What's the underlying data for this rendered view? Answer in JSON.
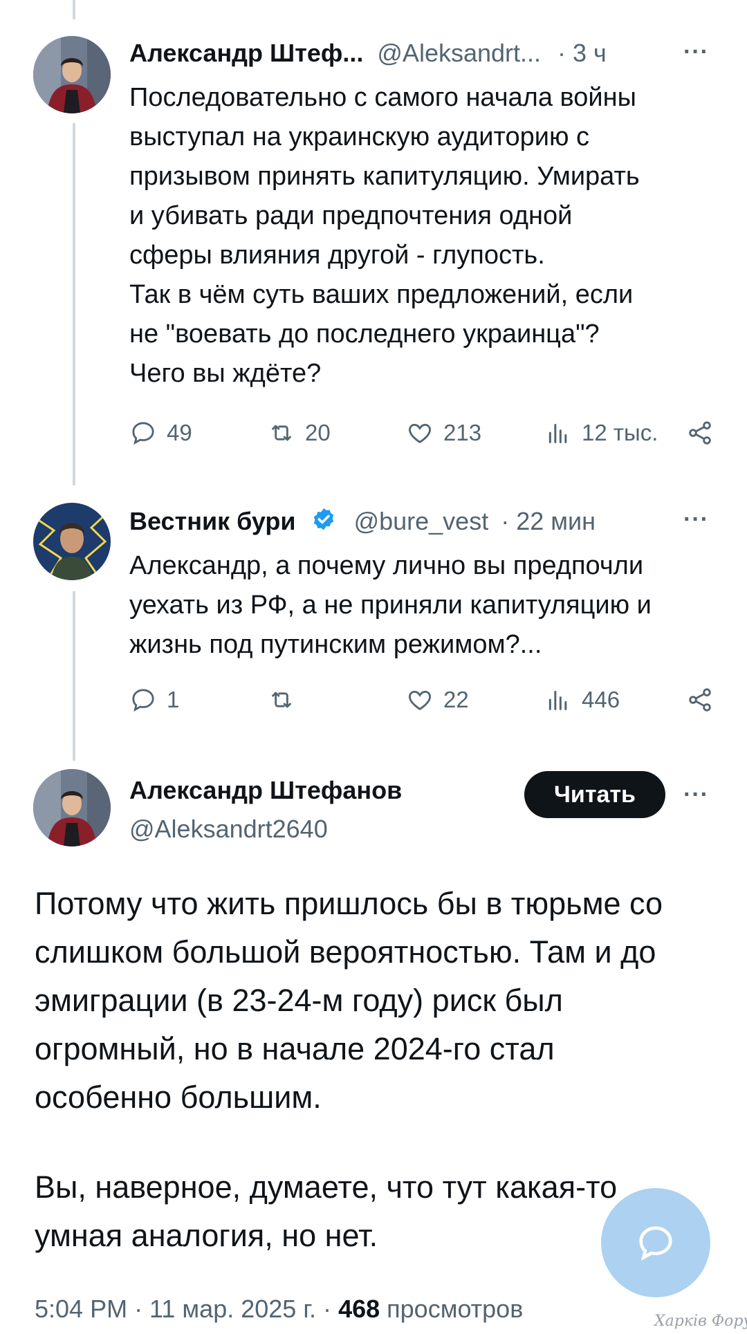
{
  "tweet1": {
    "author_name": "Александр Штеф...",
    "handle": "@Aleksandrt...",
    "time": "· 3 ч",
    "more": "···",
    "lines": [
      "Последовательно с самого начала войны",
      "выступал на украинскую аудиторию с",
      "призывом принять капитуляцию. Умирать",
      "и убивать ради предпочтения одной",
      "сферы влияния другой - глупость.",
      "Так в чём суть ваших предложений, если",
      "не \"воевать до последнего украинца\"?",
      "Чего вы ждёте?"
    ],
    "replies": "49",
    "reposts": "20",
    "likes": "213",
    "views": "12 тыс."
  },
  "tweet2": {
    "author_name": "Вестник бури",
    "handle": "@bure_vest",
    "time": "· 22 мин",
    "more": "···",
    "lines": [
      "Александр, а почему лично вы предпочли",
      "уехать из РФ, а не приняли капитуляцию и",
      "жизнь под путинским режимом?..."
    ],
    "replies": "1",
    "reposts": "",
    "likes": "22",
    "views": "446"
  },
  "main_tweet": {
    "author_name": "Александр Штефанов",
    "handle": "@Aleksandrt2640",
    "follow_label": "Читать",
    "more": "···",
    "paragraph1": [
      "Потому что жить пришлось бы в тюрьме со",
      "слишком большой вероятностью. Там и до",
      "эмиграции (в 23-24-м году) риск был",
      "огромный, но в начале 2024-го стал",
      "особенно большим."
    ],
    "paragraph2": [
      "Вы, наверное, думаете, что тут какая-то",
      "умная аналогия, но нет."
    ],
    "timestamp": "5:04 PM · 11 мар. 2025 г. ·",
    "views_count": "468",
    "views_label": "просмотров"
  },
  "watermark": "Харків Форум",
  "colors": {
    "text": "#0f1419",
    "muted": "#536471",
    "verified": "#1d9bf0",
    "thread_line": "#cfd9de",
    "fab": "#9ec9ef"
  },
  "icons": [
    "reply-icon",
    "repost-icon",
    "like-icon",
    "views-icon",
    "share-icon",
    "verified-badge-icon",
    "compose-reply-icon"
  ]
}
